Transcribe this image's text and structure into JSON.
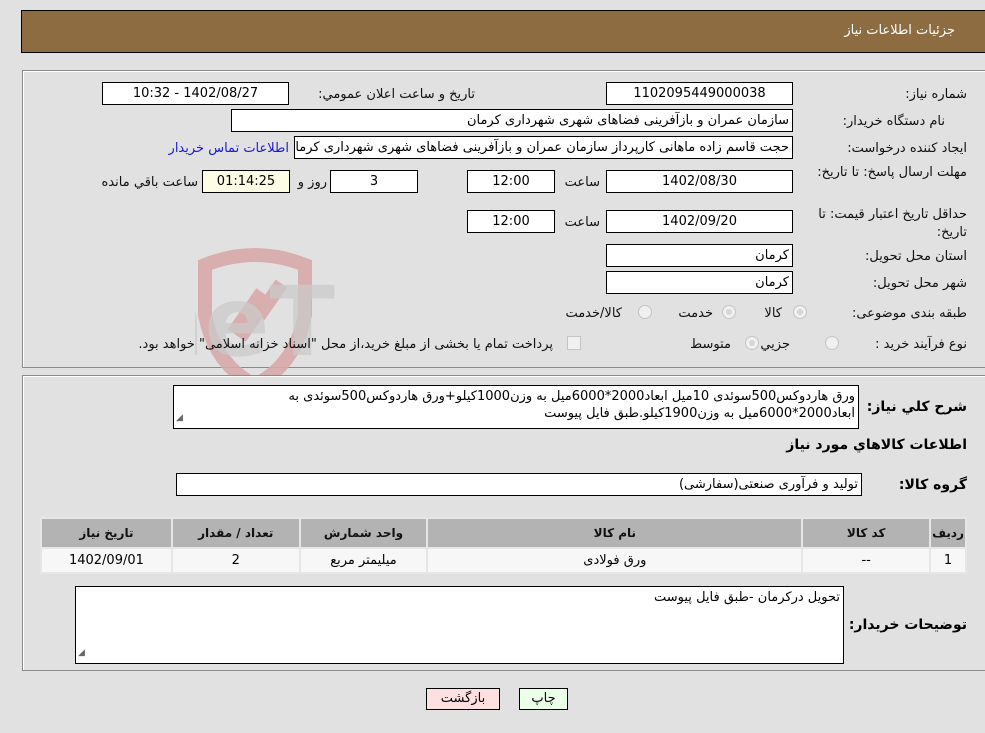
{
  "header": {
    "title": "جزئيات اطلاعات نياز"
  },
  "details": {
    "need_number": {
      "label": "شماره نياز:",
      "value": "1102095449000038"
    },
    "announce_datetime": {
      "label": "تاريخ و ساعت اعلان عمومي:",
      "value": "1402/08/27 - 10:32"
    },
    "buyer_org": {
      "label": "نام دستگاه خريدار:",
      "value": "سازمان عمران و بازآفرینی فضاهای شهری شهرداری کرمان"
    },
    "requester": {
      "label": "ايجاد کننده درخواست:",
      "value": "حجت قاسم زاده ماهانی کارپرداز سازمان عمران و بازآفرینی فضاهای شهری شهرداری کرمان",
      "contact_link": "اطلاعات تماس خريدار"
    },
    "reply_deadline": {
      "label": "مهلت ارسال پاسخ: تا تاريخ:",
      "date": "1402/08/30",
      "time_label": "ساعت",
      "time": "12:00",
      "days": "3",
      "days_label": "روز و",
      "remaining": "01:14:25",
      "remaining_label": "ساعت باقي مانده"
    },
    "price_validity": {
      "label": "حداقل تاريخ اعتبار قيمت: تا تاريخ:",
      "date": "1402/09/20",
      "time_label": "ساعت",
      "time": "12:00"
    },
    "delivery_province": {
      "label": "استان محل تحويل:",
      "value": "کرمان"
    },
    "delivery_city": {
      "label": "شهر محل تحويل:",
      "value": "کرمان"
    },
    "category": {
      "label": "طبقه بندی موضوعی:",
      "options": [
        "کالا",
        "خدمت",
        "کالا/خدمت"
      ]
    },
    "purchase_type": {
      "label": "نوع فرآيند خريد :",
      "options": [
        "جزيي",
        "متوسط"
      ],
      "payment_note": "پرداخت تمام يا بخشی از مبلغ خريد،از محل \"اسناد خزانه اسلامی\" خواهد بود."
    }
  },
  "description": {
    "label": "شرح کلي نياز:",
    "value": "ورق هاردوکس500سوئدی 10میل ابعاد2000*6000میل به وزن1000کیلو+ورق هاردوکس500سوئدی به ابعاد2000*6000میل به وزن1900کیلو.طبق فایل پیوست"
  },
  "goods": {
    "section_title": "اطلاعات کالاهاي مورد نياز",
    "group_label": "گروه کالا:",
    "group_value": "تولید و فرآوری صنعتی(سفارشی)",
    "columns": [
      "رديف",
      "کد کالا",
      "نام کالا",
      "واحد شمارش",
      "تعداد / مقدار",
      "تاريخ نياز"
    ],
    "rows": [
      [
        "1",
        "--",
        "ورق فولادی",
        "میلیمتر مربع",
        "2",
        "1402/09/01"
      ]
    ]
  },
  "buyer_notes": {
    "label": "توضيحات خريدار:",
    "value": "تحویل درکرمان -طبق فایل پیوست"
  },
  "buttons": {
    "back": "بازگشت",
    "print": "چاپ"
  },
  "watermark": {
    "text": "AriaTender.neT"
  },
  "colors": {
    "header_bg": "#8d6c41",
    "link": "#1a1ad8",
    "back_btn": "#ffe0e0",
    "print_btn": "#ecffe8"
  }
}
